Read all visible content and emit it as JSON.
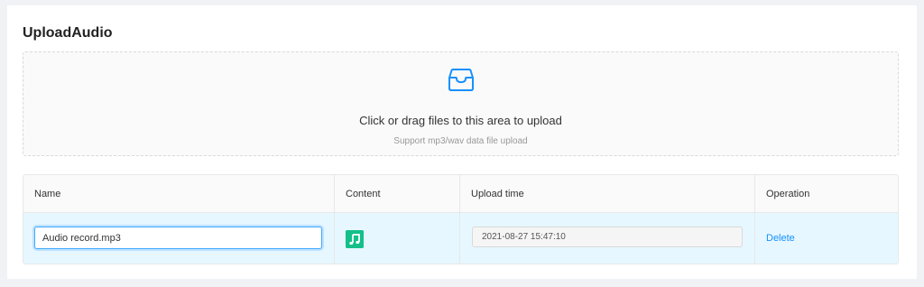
{
  "title": "UploadAudio",
  "upload": {
    "icon": "inbox-icon",
    "main_text": "Click or drag files to this area to upload",
    "hint_text": "Support mp3/wav data file upload",
    "accent": "#1890ff"
  },
  "table": {
    "headers": [
      "Name",
      "Content",
      "Upload time",
      "Operation"
    ],
    "rows": [
      {
        "name": "Audio record.mp3",
        "content_icon": "music-note-icon",
        "content_icon_color": "#13c08a",
        "upload_time": "2021-08-27 15:47:10",
        "operation": "Delete"
      }
    ]
  }
}
